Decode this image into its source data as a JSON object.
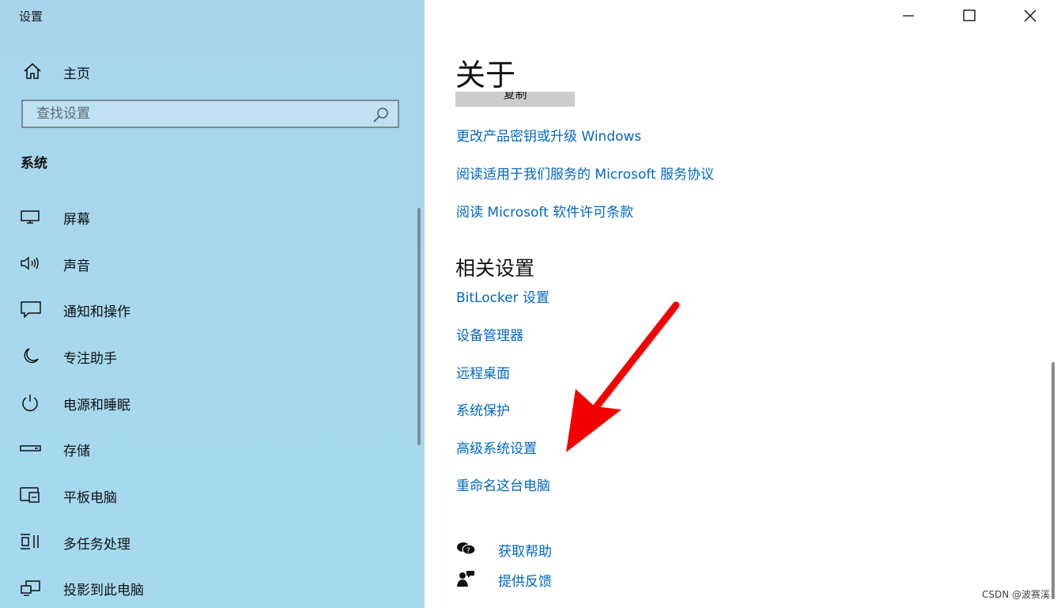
{
  "window": {
    "app_title": "设置",
    "controls": {
      "minimize": "minimize-icon",
      "maximize": "maximize-icon",
      "close": "close-icon"
    }
  },
  "nav": {
    "home_label": "主页",
    "search_placeholder": "查找设置",
    "section_title": "系统",
    "items": [
      {
        "label": "屏幕",
        "icon": "display-icon"
      },
      {
        "label": "声音",
        "icon": "speaker-icon"
      },
      {
        "label": "通知和操作",
        "icon": "notification-icon"
      },
      {
        "label": "专注助手",
        "icon": "moon-icon"
      },
      {
        "label": "电源和睡眠",
        "icon": "power-icon"
      },
      {
        "label": "存储",
        "icon": "storage-icon"
      },
      {
        "label": "平板电脑",
        "icon": "tablet-icon"
      },
      {
        "label": "多任务处理",
        "icon": "multitask-icon"
      },
      {
        "label": "投影到此电脑",
        "icon": "project-icon"
      }
    ]
  },
  "content": {
    "page_title": "关于",
    "copy_button": "复制",
    "links": [
      "更改产品密钥或升级 Windows",
      "阅读适用于我们服务的 Microsoft 服务协议",
      "阅读 Microsoft 软件许可条款"
    ],
    "related_title": "相关设置",
    "related_links": [
      "BitLocker 设置",
      "设备管理器",
      "远程桌面",
      "系统保护",
      "高级系统设置",
      "重命名这台电脑"
    ],
    "help": {
      "get_help": "获取帮助",
      "feedback": "提供反馈"
    }
  },
  "colors": {
    "nav_bg": "#a9d5ec",
    "link": "#0067c0",
    "annotation_arrow": "#f40000"
  },
  "watermark": "CSDN @波赛溪"
}
